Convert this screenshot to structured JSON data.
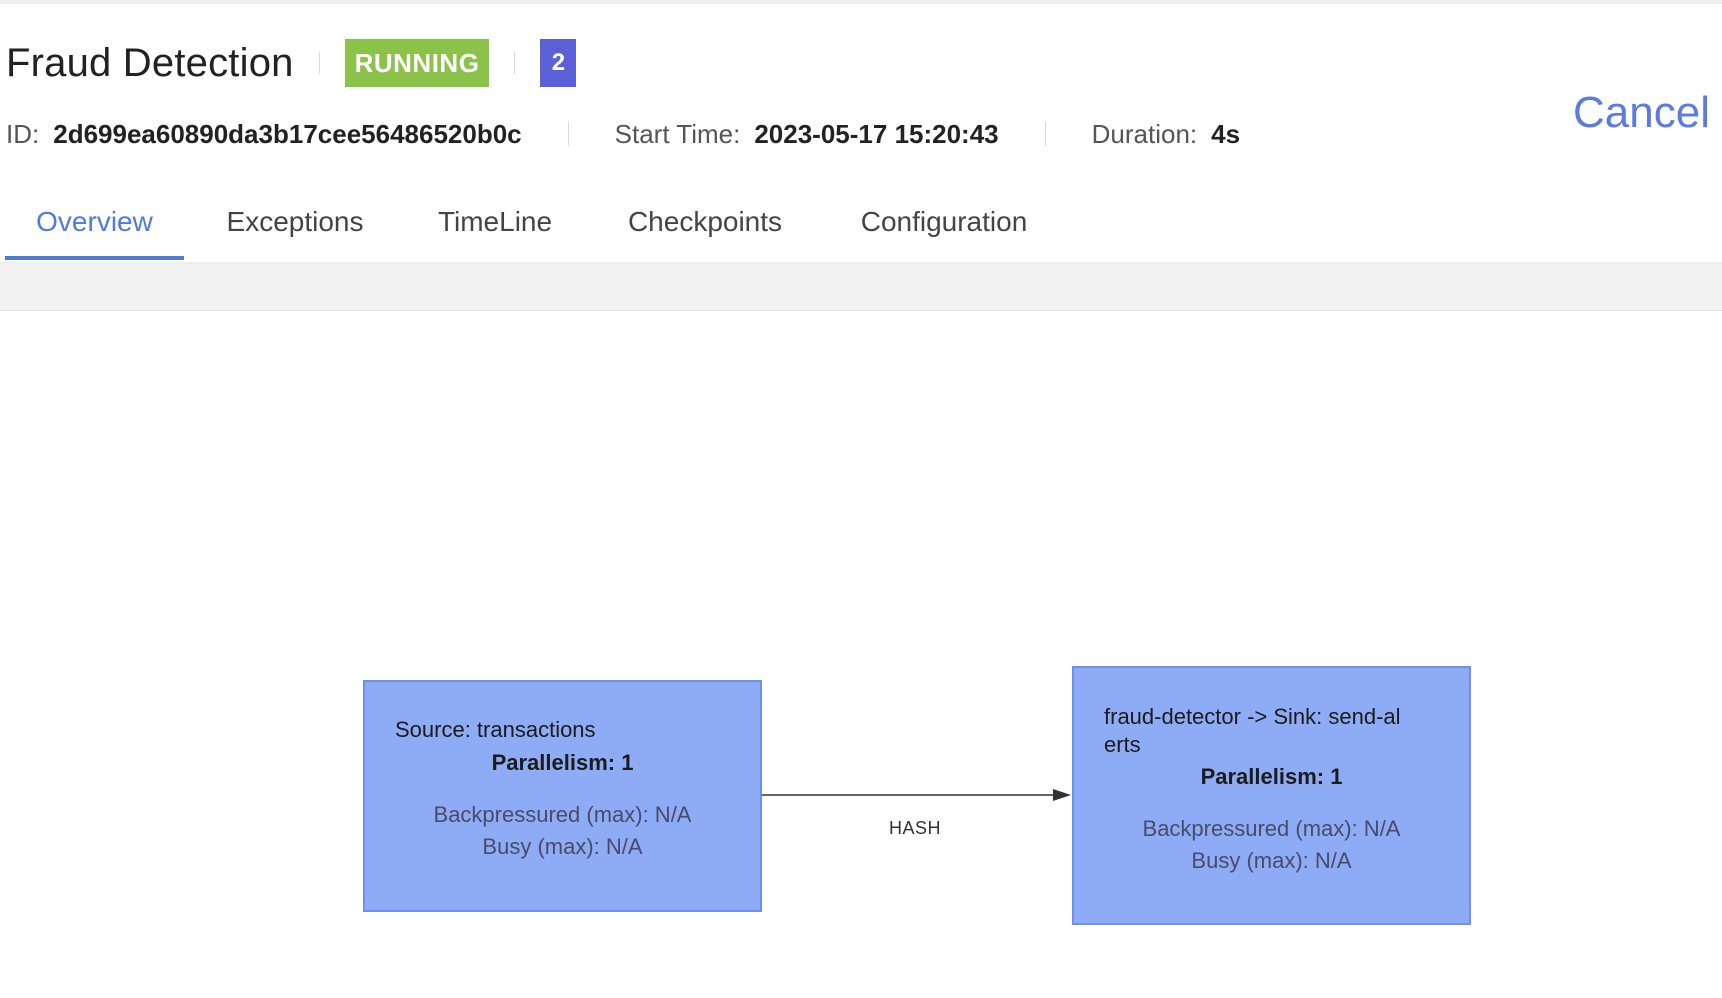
{
  "job": {
    "title": "Fraud Detection",
    "status": "RUNNING",
    "count": "2",
    "id_label": "ID:",
    "id_value": "2d699ea60890da3b17cee56486520b0c",
    "start_label": "Start Time:",
    "start_value": "2023-05-17 15:20:43",
    "duration_label": "Duration:",
    "duration_value": "4s"
  },
  "actions": {
    "cancel_label": "Cancel"
  },
  "tabs": [
    {
      "label": "Overview",
      "active": true
    },
    {
      "label": "Exceptions",
      "active": false
    },
    {
      "label": "TimeLine",
      "active": false
    },
    {
      "label": "Checkpoints",
      "active": false
    },
    {
      "label": "Configuration",
      "active": false
    }
  ],
  "graph": {
    "nodes": [
      {
        "name": "Source: transactions",
        "parallelism": "Parallelism: 1",
        "backpressured": "Backpressured (max): N/A",
        "busy": "Busy (max): N/A"
      },
      {
        "name_line1": "fraud-detector -> Sink: send-al",
        "name_line2": "erts",
        "parallelism": "Parallelism: 1",
        "backpressured": "Backpressured (max): N/A",
        "busy": "Busy (max): N/A"
      }
    ],
    "edge_label": "HASH"
  },
  "colors": {
    "running": "#8bc34a",
    "count_badge": "#5b5fd8",
    "accent": "#4f7bdc",
    "node_fill": "#8eabf5"
  }
}
